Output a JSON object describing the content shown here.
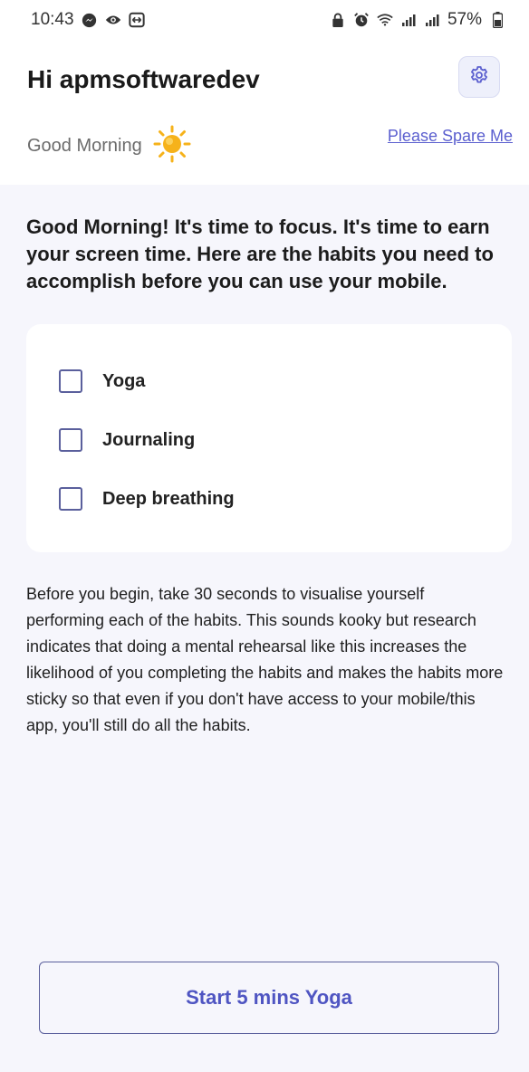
{
  "status_bar": {
    "time": "10:43",
    "left_icons": [
      "messenger-icon",
      "eye-icon",
      "screen-mirror-icon"
    ],
    "right_icons": [
      "lock-icon",
      "alarm-icon",
      "wifi-icon",
      "signal-icon",
      "signal-icon"
    ],
    "battery": "57%"
  },
  "header": {
    "title": "Hi apmsoftwaredev",
    "subgreeting": "Good Morning",
    "spare_link": "Please Spare Me"
  },
  "intro": "Good Morning! It's time to focus. It's time to earn your screen time. Here are the habits you need to accomplish before you can use your mobile.",
  "habits": [
    {
      "label": "Yoga",
      "checked": false
    },
    {
      "label": "Journaling",
      "checked": false
    },
    {
      "label": "Deep breathing",
      "checked": false
    }
  ],
  "note": "Before you begin, take 30 seconds to visualise yourself performing each of the habits. This sounds kooky but research indicates that doing a mental rehearsal like this increases the likelihood of you completing the habits and makes the habits more sticky so that even if you don't have access to your mobile/this app, you'll still do all the habits.",
  "start_button": "Start 5 mins Yoga",
  "colors": {
    "accent": "#5b5fcf",
    "background": "#f6f6fc",
    "sun": "#f6b21a"
  }
}
